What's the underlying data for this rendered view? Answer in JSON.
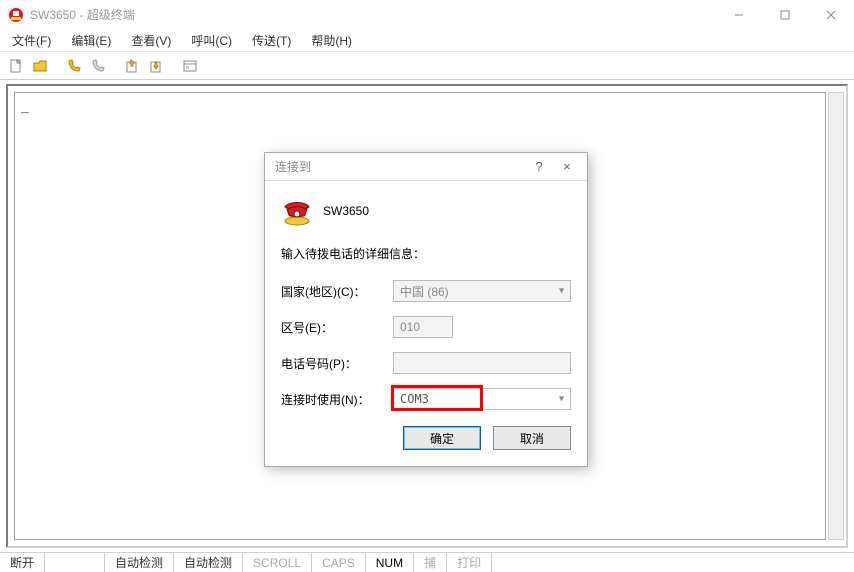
{
  "window": {
    "title": "SW3650 - 超级终端"
  },
  "menu": {
    "file": "文件(F)",
    "edit": "编辑(E)",
    "view": "查看(V)",
    "call": "呼叫(C)",
    "transfer": "传送(T)",
    "help": "帮助(H)"
  },
  "terminal": {
    "content": "_"
  },
  "statusbar": {
    "state": "断开",
    "detect1": "自动检测",
    "detect2": "自动检测",
    "scroll": "SCROLL",
    "caps": "CAPS",
    "num": "NUM",
    "capture": "捕",
    "print": "打印"
  },
  "dialog": {
    "title": "连接到",
    "help": "?",
    "close": "×",
    "connection_name": "SW3650",
    "prompt": "输入待拨电话的详细信息：",
    "country_label": "国家(地区)(C)：",
    "country_value": "中国 (86)",
    "area_label": "区号(E)：",
    "area_value": "010",
    "phone_label": "电话号码(P)：",
    "phone_value": "",
    "connect_label": "连接时使用(N)：",
    "connect_value": "COM3",
    "ok": "确定",
    "cancel": "取消"
  }
}
